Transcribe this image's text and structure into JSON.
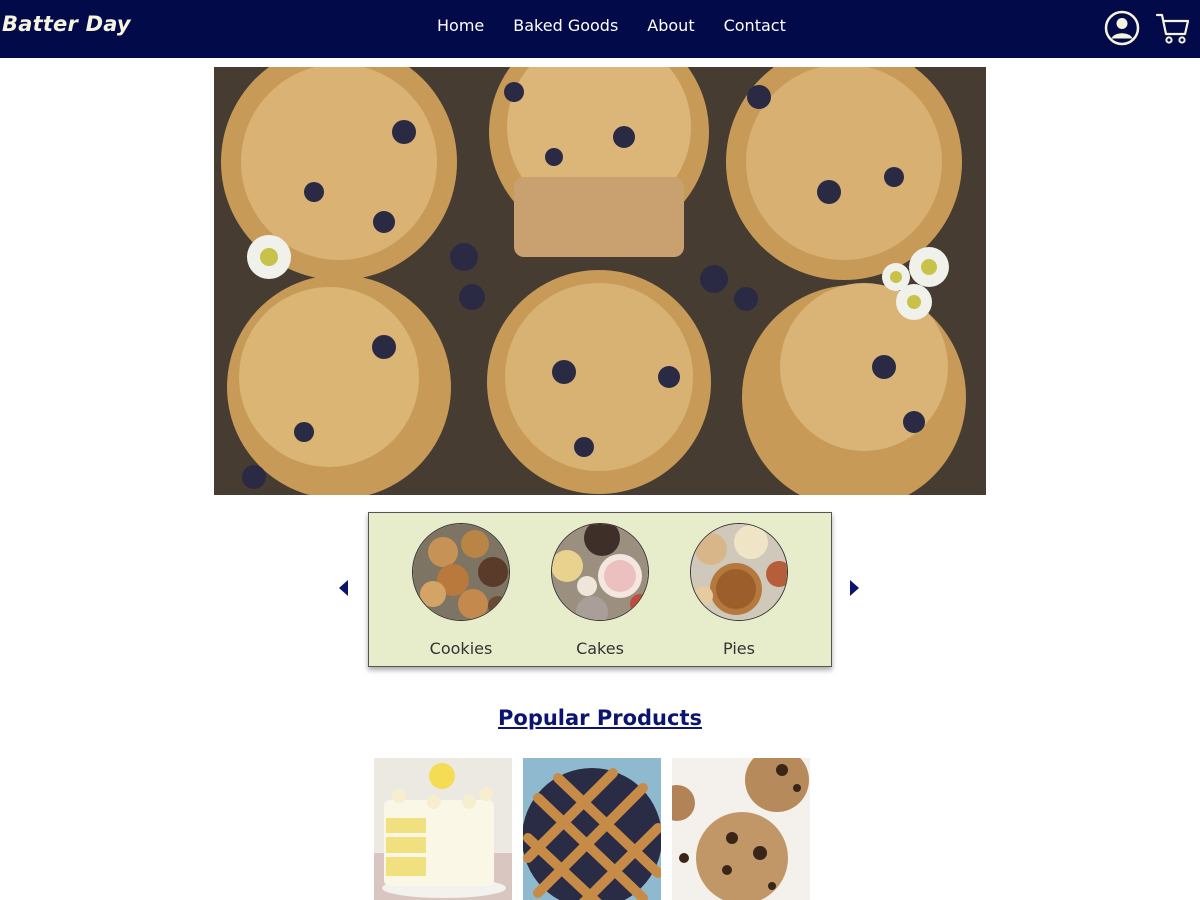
{
  "header": {
    "brand": "Batter Day",
    "nav": [
      "Home",
      "Baked Goods",
      "About",
      "Contact"
    ],
    "icons": {
      "account": "account-circle-icon",
      "cart": "shopping-cart-icon"
    }
  },
  "hero": {
    "image": "blueberry-muffins-tray-photo"
  },
  "carousel": {
    "categories": [
      {
        "label": "Cookies",
        "image": "cookies-photo"
      },
      {
        "label": "Cakes",
        "image": "cakes-photo"
      },
      {
        "label": "Pies",
        "image": "pies-photo"
      }
    ],
    "prev_icon": "caret-left-icon",
    "next_icon": "caret-right-icon"
  },
  "popular": {
    "title": "Popular Products",
    "products": [
      {
        "image": "lemon-layer-cake-photo"
      },
      {
        "image": "lattice-berry-pie-photo"
      },
      {
        "image": "chocolate-chip-cookies-photo"
      }
    ]
  },
  "colors": {
    "nav_bg": "#020a4a",
    "brand_text": "#f6f4de",
    "panel_bg": "#e7edcb",
    "title_link": "#0b1570",
    "arrow": "#0b1570"
  }
}
